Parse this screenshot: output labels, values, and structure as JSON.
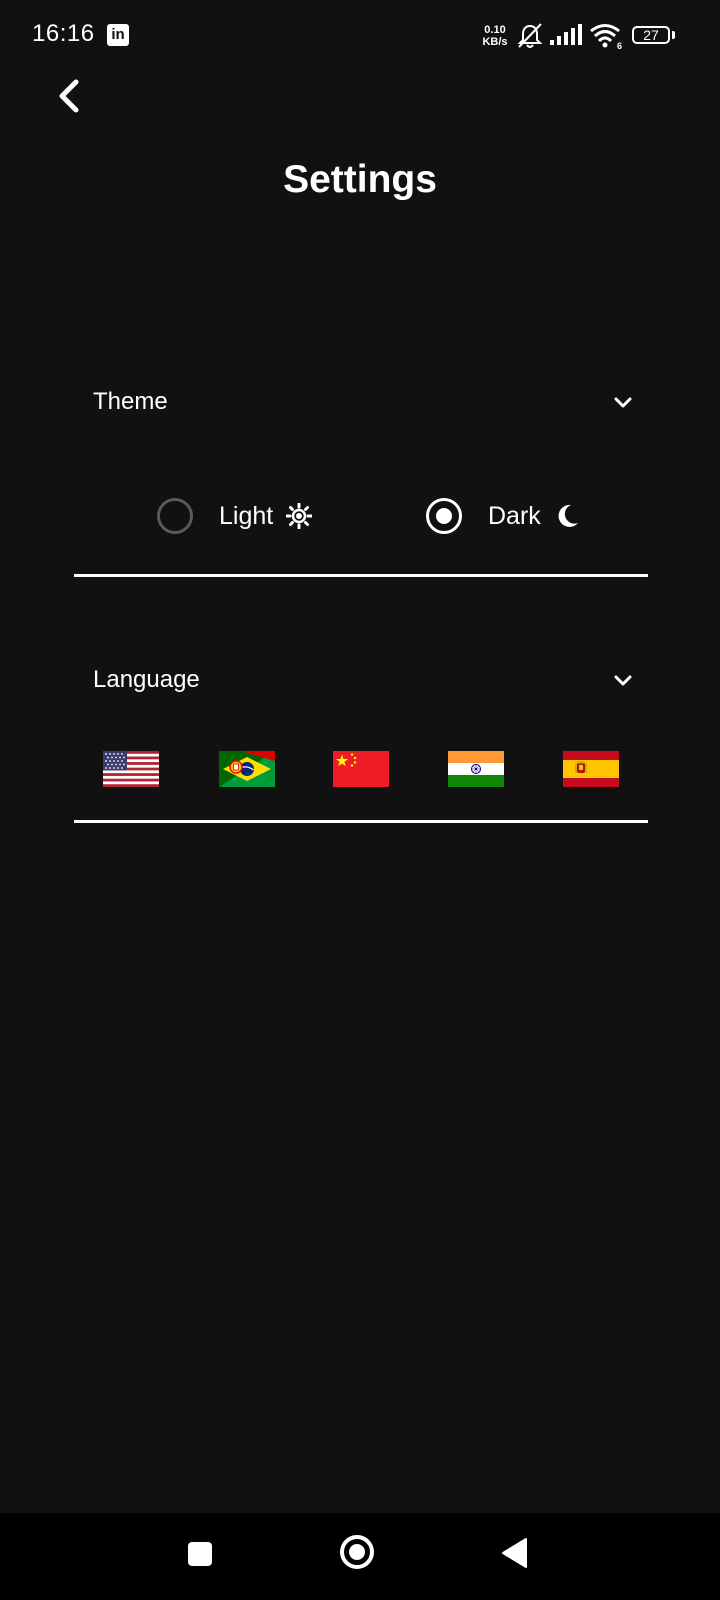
{
  "status_bar": {
    "time": "16:16",
    "app_icon": "linkedin-icon",
    "app_icon_text": "in",
    "net_speed_value": "0.10",
    "net_speed_unit": "KB/s",
    "wifi_generation": "6",
    "battery_level": "27",
    "icons": [
      "bell-off-icon",
      "signal-icon",
      "wifi-icon",
      "battery-icon"
    ]
  },
  "header": {
    "back_icon": "chevron-left-icon",
    "title": "Settings"
  },
  "theme_section": {
    "label": "Theme",
    "expand_icon": "chevron-down-icon",
    "options": [
      {
        "label": "Light",
        "icon": "sun-icon",
        "selected": false
      },
      {
        "label": "Dark",
        "icon": "moon-icon",
        "selected": true
      }
    ]
  },
  "language_section": {
    "label": "Language",
    "expand_icon": "chevron-down-icon",
    "flags": [
      {
        "icon": "flag-us-icon"
      },
      {
        "icon": "flag-pt-br-icon"
      },
      {
        "icon": "flag-cn-icon"
      },
      {
        "icon": "flag-in-icon"
      },
      {
        "icon": "flag-es-icon"
      }
    ]
  },
  "nav_bar": {
    "buttons": [
      "recents-square-icon",
      "home-circle-icon",
      "back-triangle-icon"
    ]
  },
  "colors": {
    "background": "#111111",
    "foreground": "#ffffff",
    "radio_inactive": "#5a5a5a",
    "nav_background": "#000000"
  }
}
